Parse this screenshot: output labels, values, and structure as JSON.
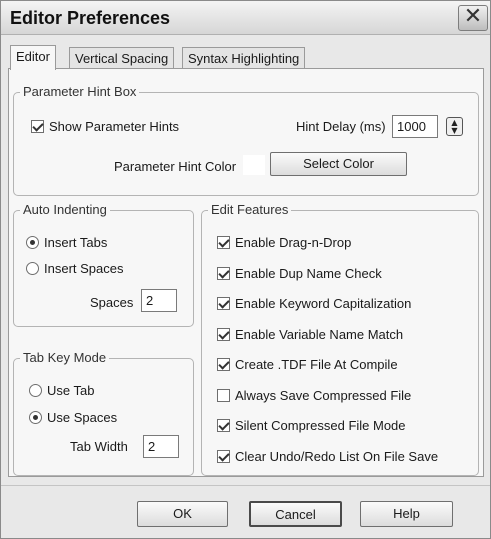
{
  "window": {
    "title": "Editor Preferences",
    "close_glyph": "✕"
  },
  "tabs": [
    {
      "label": "Editor",
      "active": true
    },
    {
      "label": "Vertical Spacing",
      "active": false
    },
    {
      "label": "Syntax Highlighting",
      "active": false
    }
  ],
  "param_hint": {
    "legend": "Parameter Hint Box",
    "show_label": "Show Parameter Hints",
    "show_checked": true,
    "delay_label": "Hint Delay (ms)",
    "delay_value": "1000",
    "color_label": "Parameter Hint Color",
    "color_value": "#ffffff",
    "select_color_label": "Select Color"
  },
  "auto_indent": {
    "legend": "Auto Indenting",
    "options": [
      {
        "label": "Insert Tabs",
        "selected": true
      },
      {
        "label": "Insert Spaces",
        "selected": false
      }
    ],
    "spaces_label": "Spaces",
    "spaces_value": "2"
  },
  "tab_key": {
    "legend": "Tab Key  Mode",
    "options": [
      {
        "label": "Use Tab",
        "selected": false
      },
      {
        "label": "Use Spaces",
        "selected": true
      }
    ],
    "width_label": "Tab Width",
    "width_value": "2"
  },
  "edit_features": {
    "legend": "Edit Features",
    "items": [
      {
        "label": "Enable Drag-n-Drop",
        "checked": true
      },
      {
        "label": "Enable Dup Name Check",
        "checked": true
      },
      {
        "label": "Enable Keyword Capitalization",
        "checked": true
      },
      {
        "label": "Enable Variable Name Match",
        "checked": true
      },
      {
        "label": "Create .TDF File At Compile",
        "checked": true
      },
      {
        "label": "Always Save Compressed File",
        "checked": false
      },
      {
        "label": "Silent Compressed File Mode",
        "checked": true
      },
      {
        "label": "Clear Undo/Redo List On File Save",
        "checked": true
      }
    ]
  },
  "buttons": {
    "ok": "OK",
    "cancel": "Cancel",
    "help": "Help"
  }
}
